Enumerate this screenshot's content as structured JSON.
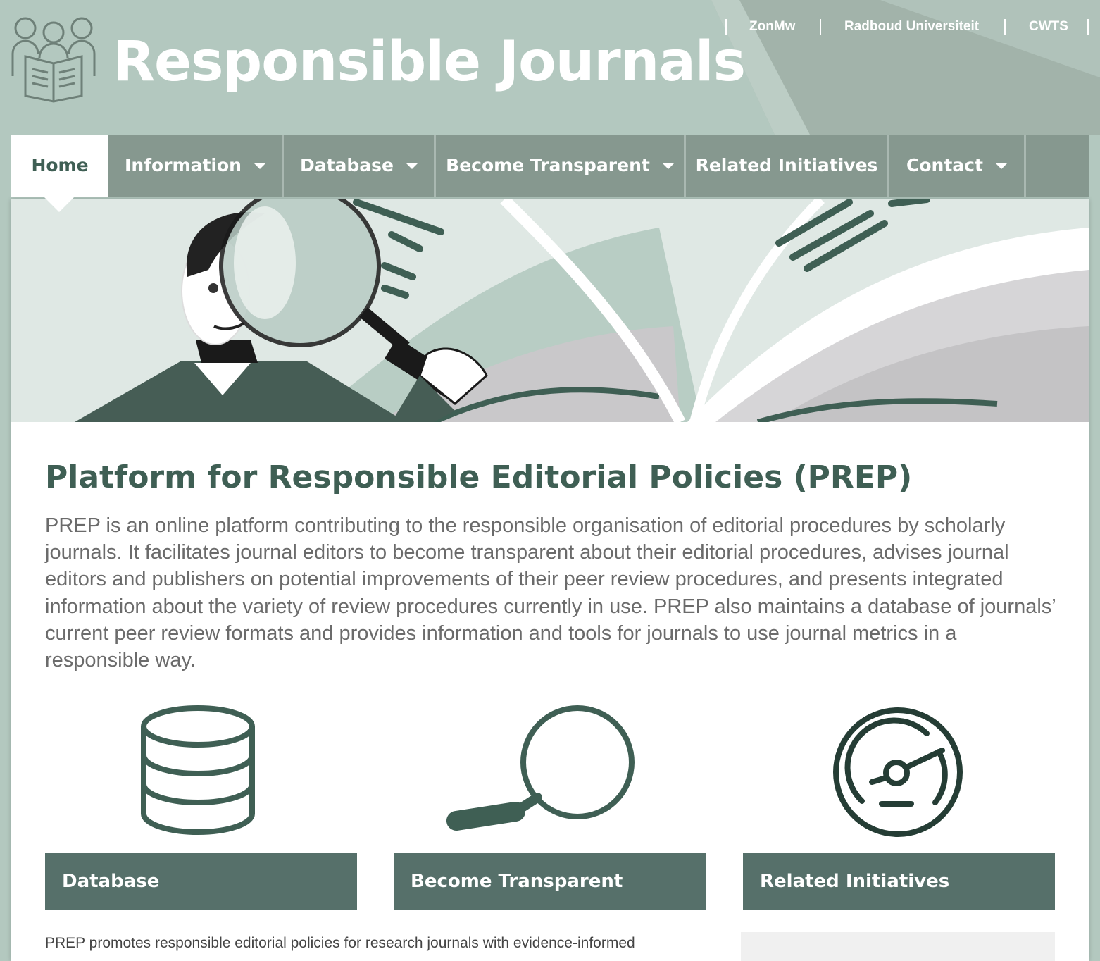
{
  "site": {
    "title": "Responsible Journals"
  },
  "top_links": [
    {
      "label": "ZonMw"
    },
    {
      "label": "Radboud Universiteit"
    },
    {
      "label": "CWTS"
    }
  ],
  "nav": [
    {
      "label": "Home",
      "active": true,
      "has_dropdown": false
    },
    {
      "label": "Information",
      "active": false,
      "has_dropdown": true
    },
    {
      "label": "Database",
      "active": false,
      "has_dropdown": true
    },
    {
      "label": "Become Transparent",
      "active": false,
      "has_dropdown": true
    },
    {
      "label": "Related Initiatives",
      "active": false,
      "has_dropdown": false
    },
    {
      "label": "Contact",
      "active": false,
      "has_dropdown": true
    }
  ],
  "main": {
    "heading": "Platform for Responsible Editorial Policies (PREP)",
    "intro": "PREP is an online platform contributing to the responsible organisation of editorial procedures by scholarly journals. It facilitates journal editors to become transparent about their editorial procedures, advises journal editors and publishers on potential improvements of their peer review procedures, and presents integrated information about the variety of review procedures currently in use. PREP also maintains a database of journals’ current peer review formats and provides information and tools for journals to use journal metrics in a responsible way.",
    "features": [
      {
        "label": "Database",
        "icon": "database-icon"
      },
      {
        "label": "Become Transparent",
        "icon": "magnifier-icon"
      },
      {
        "label": "Related Initiatives",
        "icon": "speedometer-icon"
      }
    ],
    "bottom_text": "PREP promotes responsible editorial policies for research journals with evidence-informed"
  },
  "colors": {
    "header_bg": "#b3c8bf",
    "nav_bg": "#86988f",
    "accent_dark": "#3f5f54",
    "button_bg": "#56706a",
    "body_text": "#6b6b6b"
  }
}
